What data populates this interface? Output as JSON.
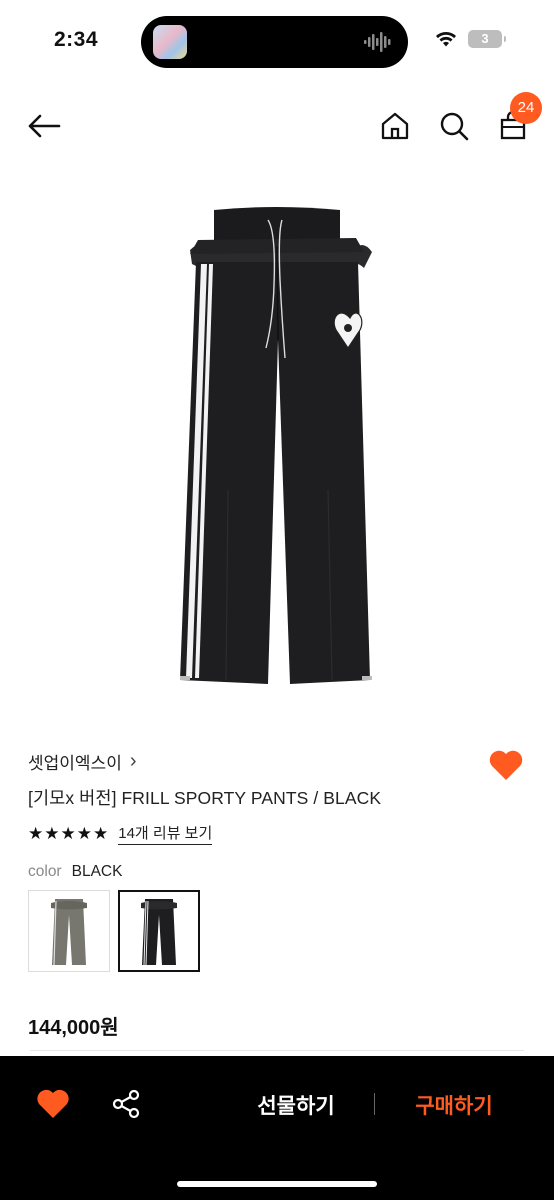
{
  "status_bar": {
    "time": "2:34",
    "battery_level": "3"
  },
  "header": {
    "cart_count": "24"
  },
  "product": {
    "brand": "셋업이엑스이",
    "brand_chevron": "›",
    "name": "[기모x 버전] FRILL SPORTY PANTS / BLACK",
    "rating_stars": 5,
    "star_glyph": "★",
    "review_link": "14개 리뷰 보기",
    "color_label": "color",
    "color_value": "BLACK",
    "price": "144,000원",
    "wishlisted": true
  },
  "color_options": [
    {
      "name": "gray-option",
      "selected": false
    },
    {
      "name": "black-option",
      "selected": true
    }
  ],
  "bottom_bar": {
    "gift_label": "선물하기",
    "buy_label": "구매하기"
  },
  "colors": {
    "accent": "#ff5a1f",
    "bar_bg": "#000000",
    "text": "#111111"
  }
}
